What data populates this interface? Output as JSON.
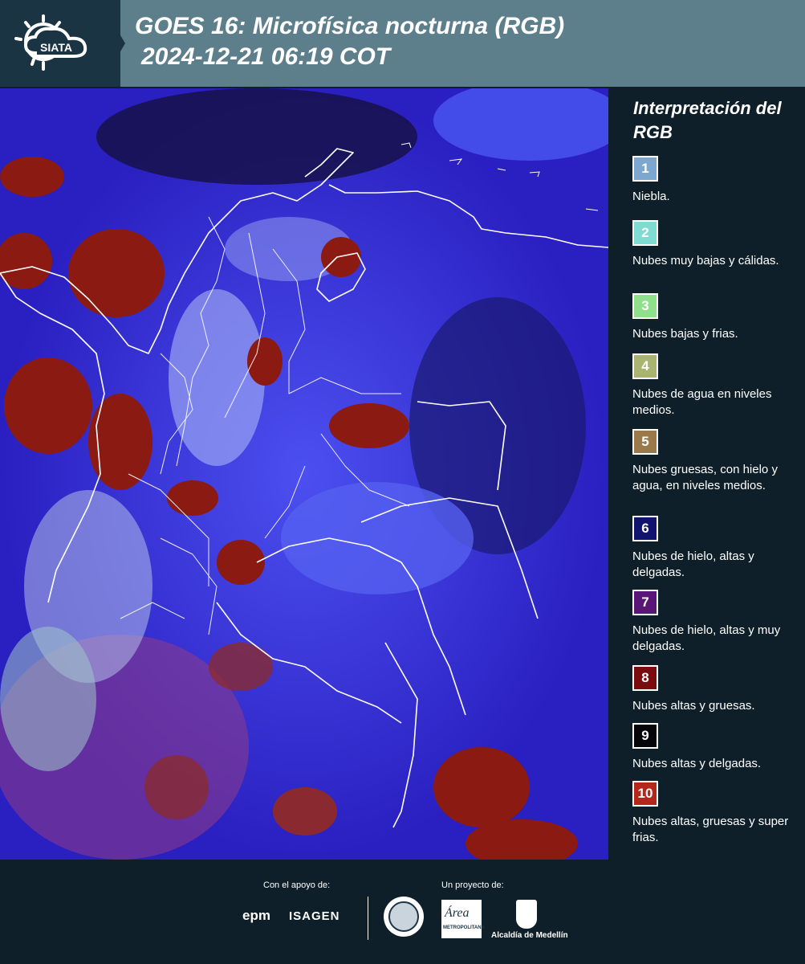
{
  "header": {
    "brand": "SIATA",
    "title_line1": "GOES 16: Microfísica nocturna (RGB)",
    "title_line2": "2024-12-21 06:19 COT"
  },
  "map": {
    "icon": "satellite-rgb-map",
    "colors": {
      "background": "#3a2bd6",
      "border_lines": "#ffffff",
      "coast_lines": "#ffffff"
    }
  },
  "legend": {
    "title": "Interpretación del RGB",
    "items": [
      {
        "number": "1",
        "label": "Niebla.",
        "color": "#7ea7cf"
      },
      {
        "number": "2",
        "label": "Nubes muy bajas y cálidas.",
        "color": "#7fdcd2"
      },
      {
        "number": "3",
        "label": "Nubes bajas y frias.",
        "color": "#8fe08a"
      },
      {
        "number": "4",
        "label": "Nubes de agua en niveles medios.",
        "color": "#a8b46f"
      },
      {
        "number": "5",
        "label": "Nubes gruesas, con hielo y agua, en niveles medios.",
        "color": "#9a7a4a"
      },
      {
        "number": "6",
        "label": "Nubes de hielo, altas y delgadas.",
        "color": "#11146e"
      },
      {
        "number": "7",
        "label": "Nubes de hielo, altas y muy delgadas.",
        "color": "#5a1676"
      },
      {
        "number": "8",
        "label": "Nubes altas y gruesas.",
        "color": "#7a0c10"
      },
      {
        "number": "9",
        "label": "Nubes altas y delgadas.",
        "color": "#05050a"
      },
      {
        "number": "10",
        "label": "Nubes altas, gruesas y super frias.",
        "color": "#b4281c"
      }
    ]
  },
  "footer": {
    "support_label": "Con el apoyo de:",
    "project_label": "Un proyecto de:",
    "sponsors": [
      "epm",
      "ISAGEN"
    ],
    "area_logo_text": "Área",
    "area_logo_sub": "METROPOLITANA",
    "alcaldia_label": "Alcaldía de Medellín"
  }
}
